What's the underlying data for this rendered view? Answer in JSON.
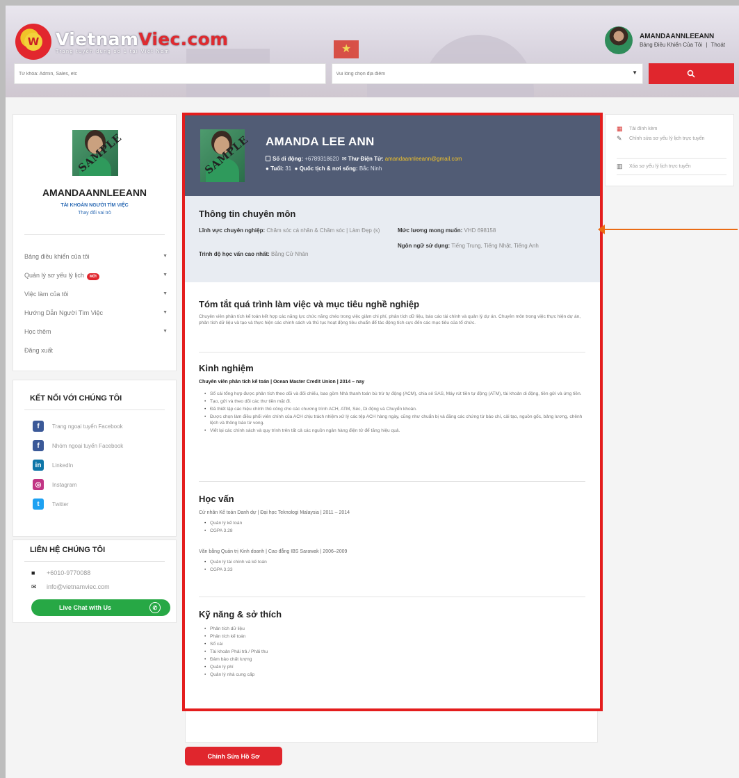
{
  "header": {
    "logo_title_a": "Vietnam",
    "logo_title_b": "Viec.com",
    "logo_subtitle": "Trang tuyển dụng số 1 tại Việt Nam",
    "username": "AMANDAANNLEEANN",
    "dashboard_link": "Bảng Điều Khiển Của Tôi",
    "divider": "|",
    "logout_link": "Thoát",
    "keyword_placeholder": "Từ khóa: Admin, Sales, etc",
    "location_placeholder": "Vui lòng chọn địa điểm",
    "search_icon": "magnifier-icon"
  },
  "sidebar": {
    "username": "AMANDAANNLEEANN",
    "role": "TÀI KHOẢN NGƯỜI TÌM VIỆC",
    "switch_role": "Thay đổi vai trò",
    "sample_stamp": "SAMPLE",
    "menu": [
      {
        "label": "Bảng điều khiển của tôi"
      },
      {
        "label": "Quản lý sơ yếu lý lịch",
        "badge": "MỚI"
      },
      {
        "label": "Việc làm của tôi"
      },
      {
        "label": "Hướng Dẫn Người Tìm Việc"
      },
      {
        "label": "Học thêm"
      },
      {
        "label": "Đăng xuất"
      }
    ],
    "connect_title": "KẾT NỐI VỚI CHÚNG TÔI",
    "social": [
      {
        "label": "Trang ngoại tuyển Facebook",
        "icon": "facebook-icon",
        "color": "#3b5998"
      },
      {
        "label": "Nhóm ngoại tuyển Facebook",
        "icon": "facebook-icon",
        "color": "#3b5998"
      },
      {
        "label": "LinkedIn",
        "icon": "linkedin-icon",
        "color": "#0e76a8"
      },
      {
        "label": "Instagram",
        "icon": "instagram-icon",
        "color": "#c13584"
      },
      {
        "label": "Twitter",
        "icon": "twitter-icon",
        "color": "#1da1f2"
      }
    ],
    "contact_title": "LIÊN HỆ CHÚNG TÔI",
    "phone": "+6010-9770088",
    "email": "info@vietnamviec.com",
    "chat_label": "Live Chat with Us"
  },
  "right_panel": {
    "actions": [
      {
        "label": "Tải đính kèm",
        "icon": "pdf-icon"
      },
      {
        "label": "Chỉnh sửa sơ yếu lý lịch trực tuyến",
        "icon": "edit-icon"
      },
      {
        "label": "Xóa sơ yếu lý lịch trực tuyến",
        "icon": "trash-icon"
      }
    ]
  },
  "resume": {
    "name": "AMANDA LEE ANN",
    "sample_stamp": "SAMPLE",
    "phone_label": "Số di động:",
    "phone": "+6789318620",
    "email_label": "Thư Điện Tử:",
    "email": "amandaannleeann@gmail.com",
    "age_label": "Tuổi:",
    "age": "31",
    "nationality_label": "Quốc tịch & nơi sống:",
    "nationality": "Bắc Ninh",
    "prof_title": "Thông tin chuyên môn",
    "field_label": "Lĩnh vực chuyên nghiệp:",
    "field_value": "Chăm sóc cá nhân & Chăm sóc | Làm Đẹp (s)",
    "edu_level_label": "Trình độ học vấn cao nhất:",
    "edu_level": "Bằng Cử Nhân",
    "salary_label": "Mức lương mong muốn:",
    "salary": "VHD 698158",
    "language_label": "Ngôn ngữ sử dụng:",
    "language": "Tiếng Trung, Tiếng Nhật, Tiếng Anh",
    "summary_title": "Tóm tắt quá trình làm việc và mục tiêu nghề nghiệp",
    "summary_text": "Chuyên viên phân tích kế toán kết hợp các năng lực chức năng chéo trong việc giảm chi phí, phân tích dữ liệu, báo cáo tài chính và quản lý dự án. Chuyên môn trong việc thực hiện dự án, phân tích dữ liệu và tạo và thực hiện các chính sách và thủ tục hoạt động tiêu chuẩn để tác động tích cực đến các mục tiêu của tổ chức.",
    "exp_title": "Kinh nghiệm",
    "job_title": "Chuyên viên phân tích kế toán | Ocean Master Credit Union | 2014 – nay",
    "job_points": [
      "Sổ cái tổng hợp được phân tích theo dõi và đối chiếu, bao gồm Nhà thanh toán bù trừ tự động (ACM), chia sẻ SAS, Máy rút tiền tự động (ATM), tài khoản di động, tiền gửi và ứng tiền.",
      "Tạo, gửi và theo dõi các thư tiền mặt đi.",
      "Đã thiết lập các hiệu chính thủ công cho các chương trình ACH, ATM, Séc, Di động và Chuyển khoản.",
      "Được chọn làm điều phối viên chính của ACH chịu trách nhiệm xử lý các tệp ACH hàng ngày, cũng như chuẩn bị và đăng các chứng từ báo chí, cải tạo, nguồn gốc, bảng lương, chênh lệch và thông báo từ vong.",
      "Viết lại các chính sách và quy trình trên tất cả các nguồn ngân hàng điện tử để tăng hiệu quả."
    ],
    "edu_title": "Học vấn",
    "edu1": "Cử nhân Kế toán Danh dự | Đại học Teknologi Malaysia | 2011 – 2014",
    "edu1_points": [
      "Quản lý kế toán",
      "CGPA 3.28"
    ],
    "edu2": "Văn bằng Quản trị Kinh doanh | Cao đẳng IBS Sarawak | 2006–2009",
    "edu2_points": [
      "Quản lý tài chính và kế toán",
      "CGPA 3.33"
    ],
    "skills_title": "Kỹ năng & sở thích",
    "skills": [
      "Phân tích dữ liệu",
      "Phân tích kế toán",
      "Sổ cái",
      "Tài khoản Phải trả / Phải thu",
      "Đảm bảo chất lượng",
      "Quản lý phí",
      "Quản lý nhà cung cấp"
    ]
  },
  "edit_button": "Chỉnh Sửa Hồ Sơ",
  "colors": {
    "accent": "#e0262d",
    "header_band": "#515c75",
    "highlight_border": "#e41d1d",
    "arrow": "#ea6b13"
  }
}
